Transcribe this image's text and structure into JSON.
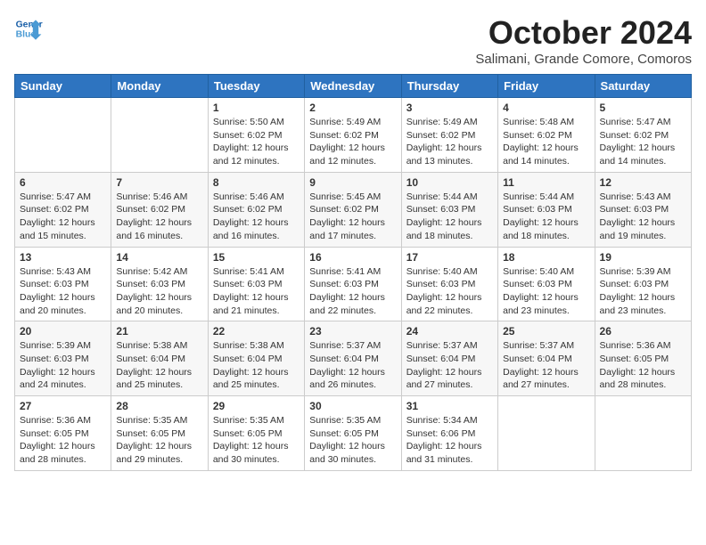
{
  "header": {
    "logo_line1": "General",
    "logo_line2": "Blue",
    "month": "October 2024",
    "location": "Salimani, Grande Comore, Comoros"
  },
  "weekdays": [
    "Sunday",
    "Monday",
    "Tuesday",
    "Wednesday",
    "Thursday",
    "Friday",
    "Saturday"
  ],
  "weeks": [
    [
      {
        "day": "",
        "info": ""
      },
      {
        "day": "",
        "info": ""
      },
      {
        "day": "1",
        "info": "Sunrise: 5:50 AM\nSunset: 6:02 PM\nDaylight: 12 hours and 12 minutes."
      },
      {
        "day": "2",
        "info": "Sunrise: 5:49 AM\nSunset: 6:02 PM\nDaylight: 12 hours and 12 minutes."
      },
      {
        "day": "3",
        "info": "Sunrise: 5:49 AM\nSunset: 6:02 PM\nDaylight: 12 hours and 13 minutes."
      },
      {
        "day": "4",
        "info": "Sunrise: 5:48 AM\nSunset: 6:02 PM\nDaylight: 12 hours and 14 minutes."
      },
      {
        "day": "5",
        "info": "Sunrise: 5:47 AM\nSunset: 6:02 PM\nDaylight: 12 hours and 14 minutes."
      }
    ],
    [
      {
        "day": "6",
        "info": "Sunrise: 5:47 AM\nSunset: 6:02 PM\nDaylight: 12 hours and 15 minutes."
      },
      {
        "day": "7",
        "info": "Sunrise: 5:46 AM\nSunset: 6:02 PM\nDaylight: 12 hours and 16 minutes."
      },
      {
        "day": "8",
        "info": "Sunrise: 5:46 AM\nSunset: 6:02 PM\nDaylight: 12 hours and 16 minutes."
      },
      {
        "day": "9",
        "info": "Sunrise: 5:45 AM\nSunset: 6:02 PM\nDaylight: 12 hours and 17 minutes."
      },
      {
        "day": "10",
        "info": "Sunrise: 5:44 AM\nSunset: 6:03 PM\nDaylight: 12 hours and 18 minutes."
      },
      {
        "day": "11",
        "info": "Sunrise: 5:44 AM\nSunset: 6:03 PM\nDaylight: 12 hours and 18 minutes."
      },
      {
        "day": "12",
        "info": "Sunrise: 5:43 AM\nSunset: 6:03 PM\nDaylight: 12 hours and 19 minutes."
      }
    ],
    [
      {
        "day": "13",
        "info": "Sunrise: 5:43 AM\nSunset: 6:03 PM\nDaylight: 12 hours and 20 minutes."
      },
      {
        "day": "14",
        "info": "Sunrise: 5:42 AM\nSunset: 6:03 PM\nDaylight: 12 hours and 20 minutes."
      },
      {
        "day": "15",
        "info": "Sunrise: 5:41 AM\nSunset: 6:03 PM\nDaylight: 12 hours and 21 minutes."
      },
      {
        "day": "16",
        "info": "Sunrise: 5:41 AM\nSunset: 6:03 PM\nDaylight: 12 hours and 22 minutes."
      },
      {
        "day": "17",
        "info": "Sunrise: 5:40 AM\nSunset: 6:03 PM\nDaylight: 12 hours and 22 minutes."
      },
      {
        "day": "18",
        "info": "Sunrise: 5:40 AM\nSunset: 6:03 PM\nDaylight: 12 hours and 23 minutes."
      },
      {
        "day": "19",
        "info": "Sunrise: 5:39 AM\nSunset: 6:03 PM\nDaylight: 12 hours and 23 minutes."
      }
    ],
    [
      {
        "day": "20",
        "info": "Sunrise: 5:39 AM\nSunset: 6:03 PM\nDaylight: 12 hours and 24 minutes."
      },
      {
        "day": "21",
        "info": "Sunrise: 5:38 AM\nSunset: 6:04 PM\nDaylight: 12 hours and 25 minutes."
      },
      {
        "day": "22",
        "info": "Sunrise: 5:38 AM\nSunset: 6:04 PM\nDaylight: 12 hours and 25 minutes."
      },
      {
        "day": "23",
        "info": "Sunrise: 5:37 AM\nSunset: 6:04 PM\nDaylight: 12 hours and 26 minutes."
      },
      {
        "day": "24",
        "info": "Sunrise: 5:37 AM\nSunset: 6:04 PM\nDaylight: 12 hours and 27 minutes."
      },
      {
        "day": "25",
        "info": "Sunrise: 5:37 AM\nSunset: 6:04 PM\nDaylight: 12 hours and 27 minutes."
      },
      {
        "day": "26",
        "info": "Sunrise: 5:36 AM\nSunset: 6:05 PM\nDaylight: 12 hours and 28 minutes."
      }
    ],
    [
      {
        "day": "27",
        "info": "Sunrise: 5:36 AM\nSunset: 6:05 PM\nDaylight: 12 hours and 28 minutes."
      },
      {
        "day": "28",
        "info": "Sunrise: 5:35 AM\nSunset: 6:05 PM\nDaylight: 12 hours and 29 minutes."
      },
      {
        "day": "29",
        "info": "Sunrise: 5:35 AM\nSunset: 6:05 PM\nDaylight: 12 hours and 30 minutes."
      },
      {
        "day": "30",
        "info": "Sunrise: 5:35 AM\nSunset: 6:05 PM\nDaylight: 12 hours and 30 minutes."
      },
      {
        "day": "31",
        "info": "Sunrise: 5:34 AM\nSunset: 6:06 PM\nDaylight: 12 hours and 31 minutes."
      },
      {
        "day": "",
        "info": ""
      },
      {
        "day": "",
        "info": ""
      }
    ]
  ]
}
